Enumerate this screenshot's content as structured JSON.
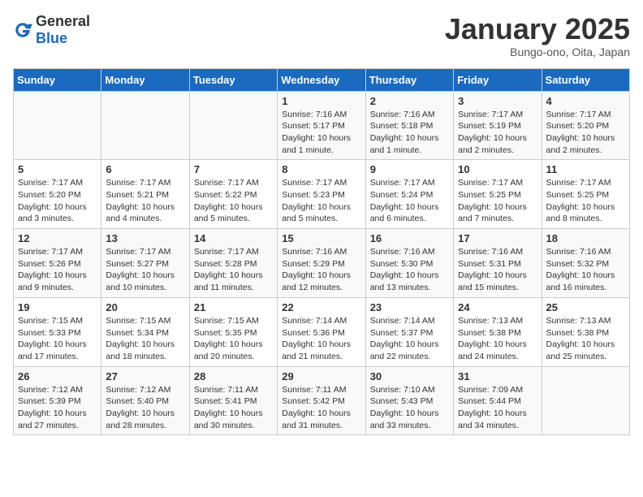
{
  "logo": {
    "general": "General",
    "blue": "Blue"
  },
  "header": {
    "title": "January 2025",
    "location": "Bungo-ono, Oita, Japan"
  },
  "weekdays": [
    "Sunday",
    "Monday",
    "Tuesday",
    "Wednesday",
    "Thursday",
    "Friday",
    "Saturday"
  ],
  "weeks": [
    [
      {
        "day": "",
        "info": ""
      },
      {
        "day": "",
        "info": ""
      },
      {
        "day": "",
        "info": ""
      },
      {
        "day": "1",
        "info": "Sunrise: 7:16 AM\nSunset: 5:17 PM\nDaylight: 10 hours\nand 1 minute."
      },
      {
        "day": "2",
        "info": "Sunrise: 7:16 AM\nSunset: 5:18 PM\nDaylight: 10 hours\nand 1 minute."
      },
      {
        "day": "3",
        "info": "Sunrise: 7:17 AM\nSunset: 5:19 PM\nDaylight: 10 hours\nand 2 minutes."
      },
      {
        "day": "4",
        "info": "Sunrise: 7:17 AM\nSunset: 5:20 PM\nDaylight: 10 hours\nand 2 minutes."
      }
    ],
    [
      {
        "day": "5",
        "info": "Sunrise: 7:17 AM\nSunset: 5:20 PM\nDaylight: 10 hours\nand 3 minutes."
      },
      {
        "day": "6",
        "info": "Sunrise: 7:17 AM\nSunset: 5:21 PM\nDaylight: 10 hours\nand 4 minutes."
      },
      {
        "day": "7",
        "info": "Sunrise: 7:17 AM\nSunset: 5:22 PM\nDaylight: 10 hours\nand 5 minutes."
      },
      {
        "day": "8",
        "info": "Sunrise: 7:17 AM\nSunset: 5:23 PM\nDaylight: 10 hours\nand 5 minutes."
      },
      {
        "day": "9",
        "info": "Sunrise: 7:17 AM\nSunset: 5:24 PM\nDaylight: 10 hours\nand 6 minutes."
      },
      {
        "day": "10",
        "info": "Sunrise: 7:17 AM\nSunset: 5:25 PM\nDaylight: 10 hours\nand 7 minutes."
      },
      {
        "day": "11",
        "info": "Sunrise: 7:17 AM\nSunset: 5:25 PM\nDaylight: 10 hours\nand 8 minutes."
      }
    ],
    [
      {
        "day": "12",
        "info": "Sunrise: 7:17 AM\nSunset: 5:26 PM\nDaylight: 10 hours\nand 9 minutes."
      },
      {
        "day": "13",
        "info": "Sunrise: 7:17 AM\nSunset: 5:27 PM\nDaylight: 10 hours\nand 10 minutes."
      },
      {
        "day": "14",
        "info": "Sunrise: 7:17 AM\nSunset: 5:28 PM\nDaylight: 10 hours\nand 11 minutes."
      },
      {
        "day": "15",
        "info": "Sunrise: 7:16 AM\nSunset: 5:29 PM\nDaylight: 10 hours\nand 12 minutes."
      },
      {
        "day": "16",
        "info": "Sunrise: 7:16 AM\nSunset: 5:30 PM\nDaylight: 10 hours\nand 13 minutes."
      },
      {
        "day": "17",
        "info": "Sunrise: 7:16 AM\nSunset: 5:31 PM\nDaylight: 10 hours\nand 15 minutes."
      },
      {
        "day": "18",
        "info": "Sunrise: 7:16 AM\nSunset: 5:32 PM\nDaylight: 10 hours\nand 16 minutes."
      }
    ],
    [
      {
        "day": "19",
        "info": "Sunrise: 7:15 AM\nSunset: 5:33 PM\nDaylight: 10 hours\nand 17 minutes."
      },
      {
        "day": "20",
        "info": "Sunrise: 7:15 AM\nSunset: 5:34 PM\nDaylight: 10 hours\nand 18 minutes."
      },
      {
        "day": "21",
        "info": "Sunrise: 7:15 AM\nSunset: 5:35 PM\nDaylight: 10 hours\nand 20 minutes."
      },
      {
        "day": "22",
        "info": "Sunrise: 7:14 AM\nSunset: 5:36 PM\nDaylight: 10 hours\nand 21 minutes."
      },
      {
        "day": "23",
        "info": "Sunrise: 7:14 AM\nSunset: 5:37 PM\nDaylight: 10 hours\nand 22 minutes."
      },
      {
        "day": "24",
        "info": "Sunrise: 7:13 AM\nSunset: 5:38 PM\nDaylight: 10 hours\nand 24 minutes."
      },
      {
        "day": "25",
        "info": "Sunrise: 7:13 AM\nSunset: 5:38 PM\nDaylight: 10 hours\nand 25 minutes."
      }
    ],
    [
      {
        "day": "26",
        "info": "Sunrise: 7:12 AM\nSunset: 5:39 PM\nDaylight: 10 hours\nand 27 minutes."
      },
      {
        "day": "27",
        "info": "Sunrise: 7:12 AM\nSunset: 5:40 PM\nDaylight: 10 hours\nand 28 minutes."
      },
      {
        "day": "28",
        "info": "Sunrise: 7:11 AM\nSunset: 5:41 PM\nDaylight: 10 hours\nand 30 minutes."
      },
      {
        "day": "29",
        "info": "Sunrise: 7:11 AM\nSunset: 5:42 PM\nDaylight: 10 hours\nand 31 minutes."
      },
      {
        "day": "30",
        "info": "Sunrise: 7:10 AM\nSunset: 5:43 PM\nDaylight: 10 hours\nand 33 minutes."
      },
      {
        "day": "31",
        "info": "Sunrise: 7:09 AM\nSunset: 5:44 PM\nDaylight: 10 hours\nand 34 minutes."
      },
      {
        "day": "",
        "info": ""
      }
    ]
  ]
}
